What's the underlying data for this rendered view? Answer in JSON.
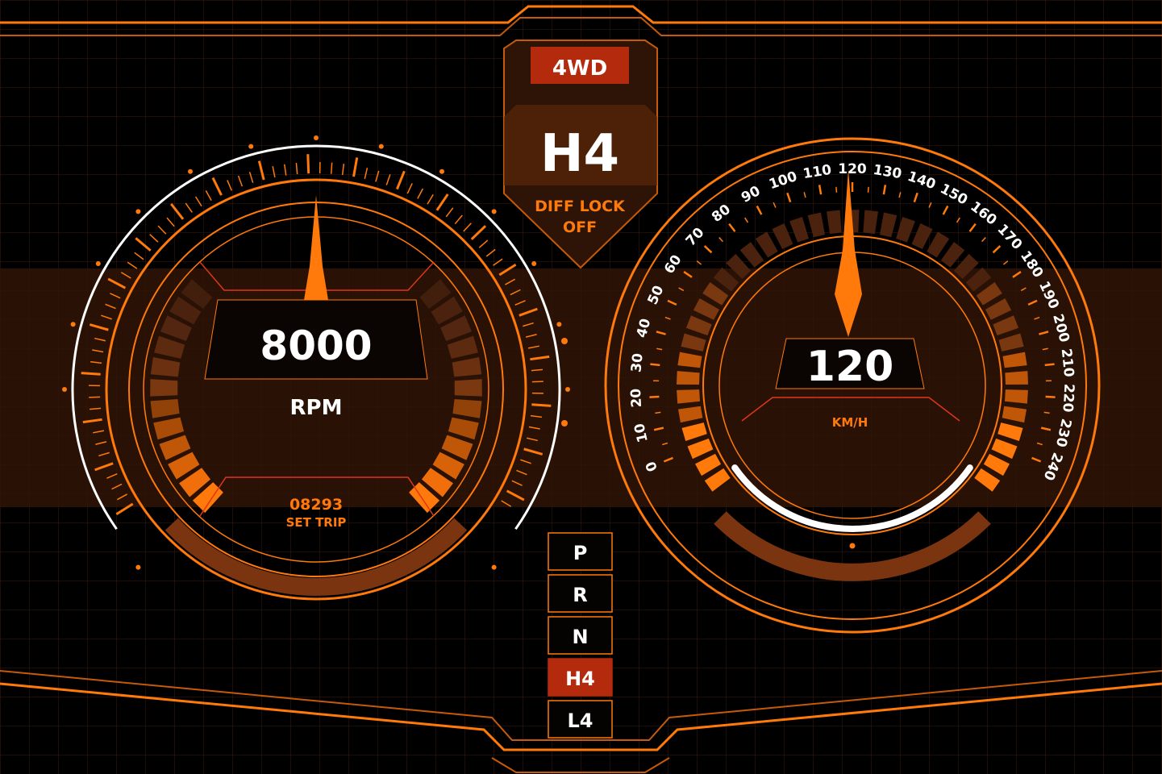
{
  "colors": {
    "background": "#000000",
    "panel_band": "#2e1406",
    "grid": "#3a1e0e",
    "accent": "#ff7a0a",
    "accent_dark": "#7a3510",
    "red": "#b32a0c",
    "red_line": "#e0361a",
    "text": "#ffffff"
  },
  "center_panel": {
    "drive_mode": "4WD",
    "gear_range": "H4",
    "diff_lock_label": "DIFF LOCK",
    "diff_lock_state": "OFF"
  },
  "tachometer": {
    "value": "8000",
    "unit": "RPM",
    "trip_value": "08293",
    "trip_label": "SET TRIP"
  },
  "speedometer": {
    "value": "120",
    "unit": "KM/H",
    "scale_labels": [
      "0",
      "10",
      "20",
      "30",
      "40",
      "50",
      "60",
      "70",
      "80",
      "90",
      "100",
      "110",
      "120",
      "130",
      "140",
      "150",
      "160",
      "170",
      "180",
      "190",
      "200",
      "210",
      "220",
      "230",
      "240"
    ]
  },
  "gear_selector": {
    "items": [
      {
        "label": "P",
        "active": false
      },
      {
        "label": "R",
        "active": false
      },
      {
        "label": "N",
        "active": false
      },
      {
        "label": "H4",
        "active": true
      },
      {
        "label": "L4",
        "active": false
      }
    ]
  }
}
